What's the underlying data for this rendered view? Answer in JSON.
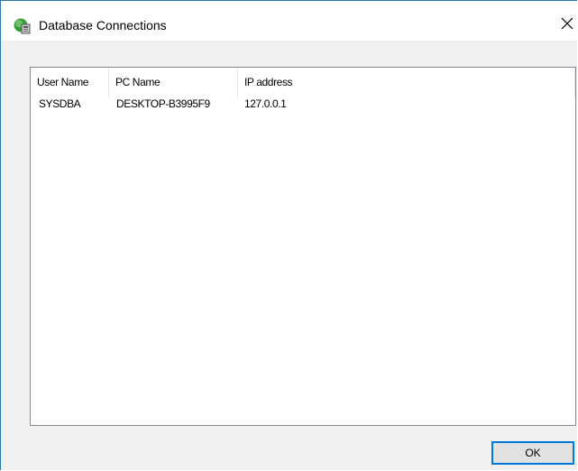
{
  "window": {
    "title": "Database Connections",
    "icon": "database-connection-icon",
    "close_icon": "close-icon"
  },
  "table": {
    "columns": [
      "User Name",
      "PC Name",
      "IP address"
    ],
    "rows": [
      [
        "SYSDBA",
        "DESKTOP-B3995F9",
        "127.0.0.1"
      ]
    ]
  },
  "buttons": {
    "ok_label": "OK"
  },
  "colors": {
    "accent": "#0078d7",
    "border": "#2b79b5",
    "dialog_bg": "#f0f0f0"
  }
}
